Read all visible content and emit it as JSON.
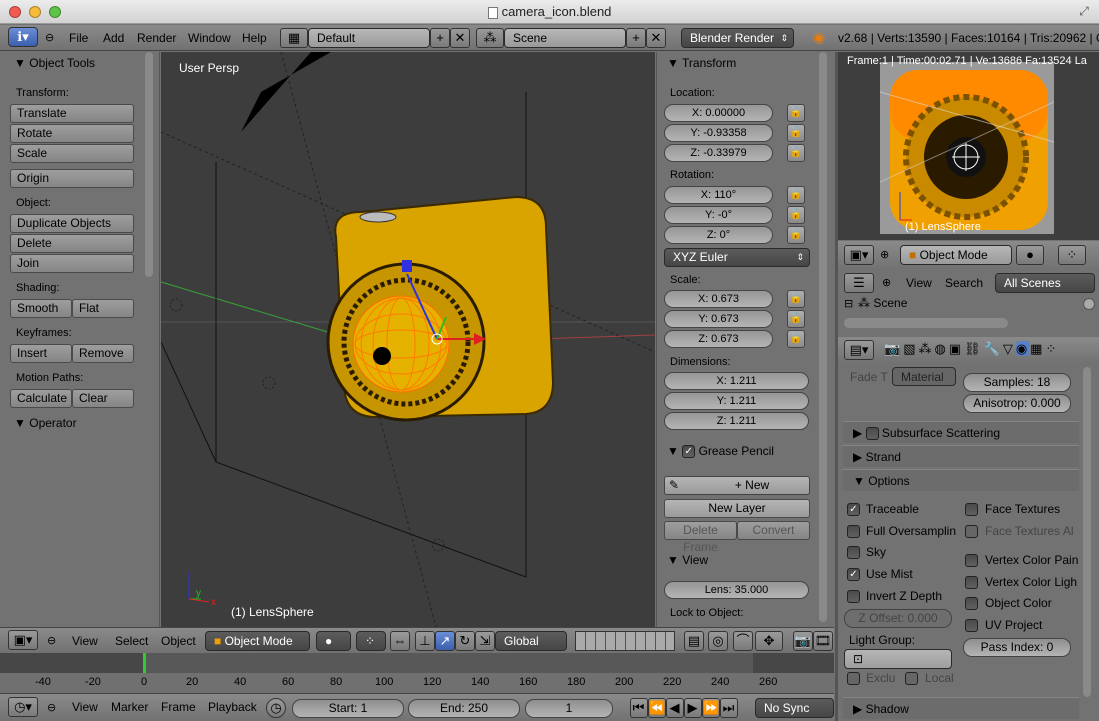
{
  "window": {
    "title": "camera_icon.blend"
  },
  "info_header": {
    "menus": [
      "File",
      "Add",
      "Render",
      "Window",
      "Help"
    ],
    "screen_layout": "Default",
    "scene": "Scene",
    "render_engine": "Blender Render",
    "stats": "v2.68 | Verts:13590 | Faces:10164 | Tris:20962 | O"
  },
  "tool_shelf": {
    "title": "Object Tools",
    "transform_label": "Transform:",
    "translate": "Translate",
    "rotate": "Rotate",
    "scale": "Scale",
    "origin": "Origin",
    "object_label": "Object:",
    "duplicate": "Duplicate Objects",
    "delete": "Delete",
    "join": "Join",
    "shading_label": "Shading:",
    "smooth": "Smooth",
    "flat": "Flat",
    "keyframes_label": "Keyframes:",
    "insert": "Insert",
    "remove": "Remove",
    "motion_label": "Motion Paths:",
    "calculate": "Calculate",
    "clear": "Clear",
    "operator": "Operator"
  },
  "viewport": {
    "view_name": "User Persp",
    "object_name": "(1) LensSphere",
    "axis_y": "y",
    "axis_x": "x"
  },
  "transform_panel": {
    "title": "Transform",
    "location_label": "Location:",
    "loc_x": "X: 0.00000",
    "loc_y": "Y: -0.93358",
    "loc_z": "Z: -0.33979",
    "rotation_label": "Rotation:",
    "rot_x": "X: 110°",
    "rot_y": "Y: -0°",
    "rot_z": "Z: 0°",
    "rot_mode": "XYZ Euler",
    "scale_label": "Scale:",
    "sc_x": "X: 0.673",
    "sc_y": "Y: 0.673",
    "sc_z": "Z: 0.673",
    "dimensions_label": "Dimensions:",
    "dim_x": "X: 1.211",
    "dim_y": "Y: 1.211",
    "dim_z": "Z: 1.211",
    "grease_pencil": "Grease Pencil",
    "new": "New",
    "new_layer": "New Layer",
    "delete_frame": "Delete Frame",
    "convert": "Convert",
    "view_title": "View",
    "lens": "Lens: 35.000",
    "lock_label": "Lock to Object:"
  },
  "render_view": {
    "info": "Frame:1 | Time:00:02.71 | Ve:13686 Fa:13524 La",
    "object_name": "(1) LensSphere"
  },
  "props_header": {
    "mode": "Object Mode"
  },
  "outliner": {
    "view": "View",
    "search": "Search",
    "filter": "All Scenes",
    "scene_item": "Scene"
  },
  "material_props": {
    "fade_label": "Fade T",
    "fade_value": "Material",
    "samples": "Samples: 18",
    "anisotropy": "Anisotrop: 0.000",
    "subsurface": "Subsurface Scattering",
    "strand": "Strand",
    "options": "Options",
    "traceable": "Traceable",
    "full_oversampling": "Full Oversamplin",
    "sky": "Sky",
    "use_mist": "Use Mist",
    "invert_z": "Invert Z Depth",
    "z_offset": "Z Offset: 0.000",
    "light_group": "Light Group:",
    "exclusive": "Exclu",
    "local": "Local",
    "face_textures": "Face Textures",
    "face_textures_alpha": "Face Textures Al",
    "vertex_color_paint": "Vertex Color Pain",
    "vertex_color_light": "Vertex Color Ligh",
    "object_color": "Object Color",
    "uv_project": "UV Project",
    "pass_index": "Pass Index: 0",
    "shadow": "Shadow"
  },
  "view3d_header": {
    "view": "View",
    "select": "Select",
    "object": "Object",
    "mode": "Object Mode",
    "orientation": "Global"
  },
  "timeline": {
    "ticks": [
      "-40",
      "-20",
      "0",
      "20",
      "40",
      "60",
      "80",
      "100",
      "120",
      "140",
      "160",
      "180",
      "200",
      "220",
      "240",
      "260"
    ],
    "view": "View",
    "marker": "Marker",
    "frame": "Frame",
    "playback": "Playback",
    "start": "Start: 1",
    "end": "End: 250",
    "current": "1",
    "sync": "No Sync"
  }
}
